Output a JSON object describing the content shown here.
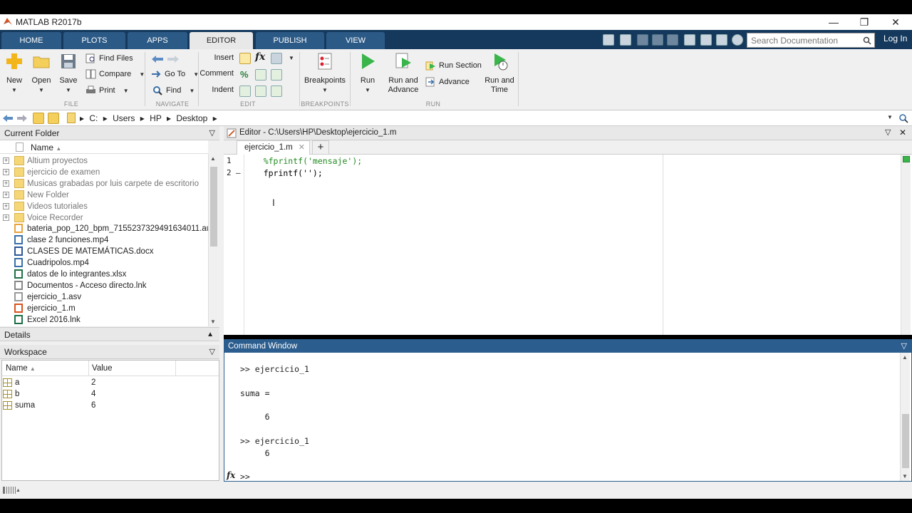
{
  "window": {
    "title": "MATLAB R2017b"
  },
  "tabs": [
    {
      "label": "HOME"
    },
    {
      "label": "PLOTS"
    },
    {
      "label": "APPS"
    },
    {
      "label": "EDITOR"
    },
    {
      "label": "PUBLISH"
    },
    {
      "label": "VIEW"
    }
  ],
  "search": {
    "placeholder": "Search Documentation"
  },
  "login_label": "Log In",
  "ribbon": {
    "file": {
      "new": "New",
      "open": "Open",
      "save": "Save",
      "find_files": "Find Files",
      "compare": "Compare",
      "print": "Print",
      "group": "FILE"
    },
    "navigate": {
      "go_to": "Go To",
      "find": "Find",
      "group": "NAVIGATE"
    },
    "edit": {
      "insert": "Insert",
      "comment": "Comment",
      "indent": "Indent",
      "group": "EDIT"
    },
    "breakpoints": {
      "label": "Breakpoints",
      "group": "BREAKPOINTS"
    },
    "run": {
      "run": "Run",
      "run_and_advance_1": "Run and",
      "run_and_advance_2": "Advance",
      "run_section": "Run Section",
      "advance": "Advance",
      "run_and_time_1": "Run and",
      "run_and_time_2": "Time",
      "group": "RUN"
    }
  },
  "path": {
    "drive": "C:",
    "p1": "Users",
    "p2": "HP",
    "p3": "Desktop"
  },
  "current_folder": {
    "title": "Current Folder",
    "name_header": "Name",
    "items": [
      {
        "name": "Altium proyectos",
        "type": "folder"
      },
      {
        "name": "ejercicio de examen",
        "type": "folder"
      },
      {
        "name": "Musicas grabadas por luis carpete de escritorio",
        "type": "folder"
      },
      {
        "name": "New Folder",
        "type": "folder"
      },
      {
        "name": "Videos tutoriales",
        "type": "folder"
      },
      {
        "name": "Voice Recorder",
        "type": "folder"
      },
      {
        "name": "bateria_pop_120_bpm_7155237329491634011.aup",
        "type": "aup"
      },
      {
        "name": "clase 2 funciones.mp4",
        "type": "mp4"
      },
      {
        "name": "CLASES DE MATEMÁTICAS.docx",
        "type": "docx"
      },
      {
        "name": "Cuadripolos.mp4",
        "type": "mp4"
      },
      {
        "name": "datos de lo integrantes.xlsx",
        "type": "xlsx"
      },
      {
        "name": "Documentos - Acceso directo.lnk",
        "type": "lnk"
      },
      {
        "name": "ejercicio_1.asv",
        "type": "asv"
      },
      {
        "name": "ejercicio_1.m",
        "type": "m"
      },
      {
        "name": "Excel 2016.lnk",
        "type": "xlsx"
      }
    ]
  },
  "details": {
    "title": "Details"
  },
  "workspace": {
    "title": "Workspace",
    "col_name": "Name",
    "col_value": "Value",
    "rows": [
      {
        "name": "a",
        "value": "2"
      },
      {
        "name": "b",
        "value": "4"
      },
      {
        "name": "suma",
        "value": "6"
      }
    ]
  },
  "editor": {
    "title": "Editor - C:\\Users\\HP\\Desktop\\ejercicio_1.m",
    "tab": "ejercicio_1.m",
    "lines": [
      {
        "num": "1",
        "marker": "",
        "code": "    %fprintf('mensaje');"
      },
      {
        "num": "2",
        "marker": "–",
        "code": "    fprintf('');"
      }
    ]
  },
  "command_window": {
    "title": "Command Window",
    "lines": [
      ">> ejercicio_1",
      "",
      "suma =",
      "",
      "     6",
      "",
      ">> ejercicio_1",
      "     6"
    ],
    "prompt": ">>",
    "fx": "fx"
  },
  "colors": {
    "tabbar": "#14395d",
    "tab": "#2c5a86",
    "ribbon": "#f0f0f0",
    "cmd_border": "#2b5d8e"
  }
}
